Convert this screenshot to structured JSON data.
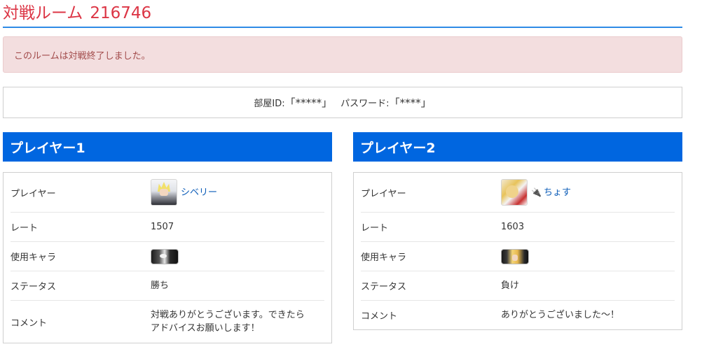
{
  "header": {
    "title": "対戦ルーム",
    "room_number": "216746"
  },
  "alert": {
    "message": "このルームは対戦終了しました。"
  },
  "room_info": {
    "id_label": "部屋ID:",
    "id_value": "「*****」",
    "password_label": "パスワード:",
    "password_value": "「****」"
  },
  "labels": {
    "player": "プレイヤー",
    "rate": "レート",
    "character": "使用キャラ",
    "status": "ステータス",
    "comment": "コメント"
  },
  "players": [
    {
      "heading": "プレイヤー1",
      "name": "シベリー",
      "rate": "1507",
      "status": "勝ち",
      "comment_line1": "対戦ありがとうございます。できたら",
      "comment_line2": "アドバイスお願いします！",
      "icon": "cloud-avatar-icon",
      "character_icon": "character-icon"
    },
    {
      "heading": "プレイヤー2",
      "name": "ちょす",
      "rate": "1603",
      "status": "負け",
      "comment_line1": "ありがとうございました～！",
      "icon": "avatar-icon",
      "extra_icon": "plug-icon",
      "character_icon": "character-icon"
    }
  ],
  "colors": {
    "title": "#dc3545",
    "header_bar": "#0066e0",
    "alert_bg": "#f3dedf",
    "alert_text": "#a24b4b",
    "link": "#0b5cb8",
    "title_underline": "#2e8ae6"
  }
}
